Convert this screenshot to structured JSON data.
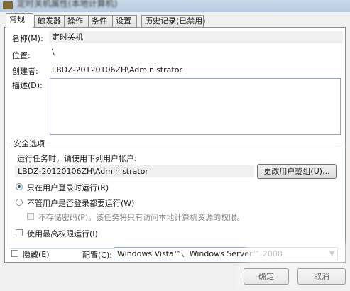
{
  "window": {
    "title": "定时关机属性(本地计算机)"
  },
  "tabs": [
    {
      "label": "常规"
    },
    {
      "label": "触发器"
    },
    {
      "label": "操作"
    },
    {
      "label": "条件"
    },
    {
      "label": "设置"
    },
    {
      "label": "历史记录(已禁用)"
    }
  ],
  "general": {
    "name_label": "名称(M):",
    "name_value": "定时关机",
    "location_label": "位置:",
    "location_value": "\\",
    "author_label": "创建者:",
    "author_value": "LBDZ-20120106ZH\\Administrator",
    "description_label": "描述(D):",
    "description_value": ""
  },
  "security": {
    "group_title": "安全选项",
    "run_as_prompt": "运行任务时，请使用下列用户帐户:",
    "user_account": "LBDZ-20120106ZH\\Administrator",
    "change_user_button": "更改用户或组(U)...",
    "option_logged_on": "只在用户登录时运行(R)",
    "option_whether_logged_on": "不管用户是否登录都要运行(W)",
    "do_not_store_password": "不存储密码(P)。该任务将只有访问本地计算机资源的权限。",
    "run_highest_privileges": "使用最高权限运行(I)",
    "selected_option": "option_logged_on"
  },
  "footer": {
    "hidden_label": "隐藏(E)",
    "configure_label": "配置(C):",
    "configure_value": "Windows Vista™、Windows Server™ 2008",
    "ok_button": "确定",
    "cancel_button": "取消"
  }
}
